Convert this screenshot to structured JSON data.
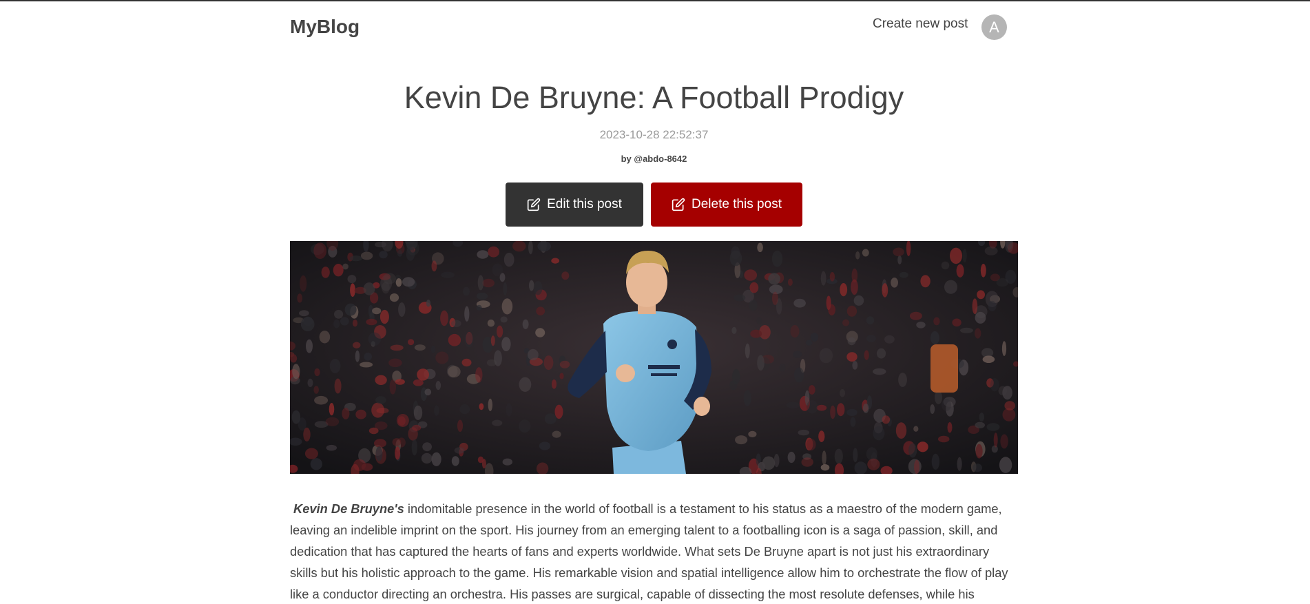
{
  "nav": {
    "brand": "MyBlog",
    "create_link": "Create new post",
    "avatar_initial": "A"
  },
  "post": {
    "title": "Kevin De Bruyne: A Football Prodigy",
    "date": "2023-10-28 22:52:37",
    "author": "by @abdo-8642",
    "edit_label": "Edit this post",
    "delete_label": "Delete this post",
    "edit_icon": "pencil-square-icon",
    "delete_icon": "pencil-square-icon",
    "cover_alt": "Kevin De Bruyne running in a sky-blue kit",
    "body_lead": "Kevin De Bruyne's",
    "body_text": "indomitable presence in the world of football is a testament to his status as a maestro of the modern game, leaving an indelible imprint on the sport. His journey from an emerging talent to a footballing icon is a saga of passion, skill, and dedication that has captured the hearts of fans and experts worldwide. What sets De Bruyne apart is not just his extraordinary skills but his holistic approach to the game. His remarkable vision and spatial intelligence allow him to orchestrate the flow of play like a conductor directing an orchestra. His passes are surgical, capable of dissecting the most resolute defenses, while his dribbling"
  },
  "colors": {
    "text": "#444444",
    "muted": "#9a9a9a",
    "edit_button": "#333333",
    "delete_button": "#a50000",
    "avatar": "#b5b5b5",
    "top_border": "#333333"
  }
}
